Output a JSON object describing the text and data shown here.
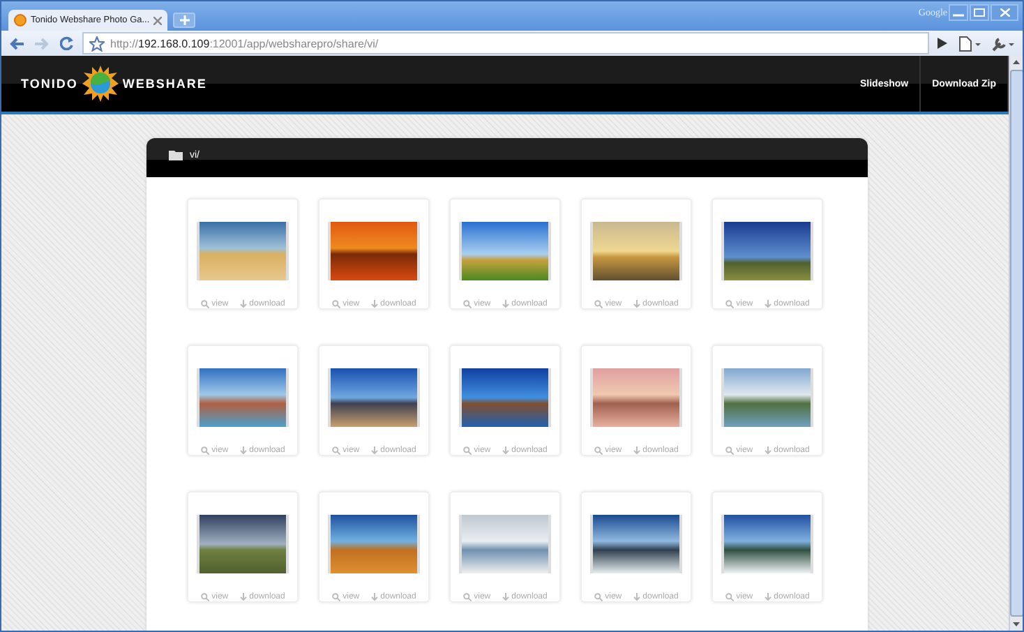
{
  "browser": {
    "tab_title": "Tonido Webshare Photo Ga...",
    "brand": "Google",
    "url": {
      "scheme": "http://",
      "host": "192.168.0.109",
      "rest": ":12001/app/websharepro/share/vi/"
    }
  },
  "header": {
    "logo_left": "TONIDO",
    "logo_right": "WEBSHARE",
    "nav": [
      "Slideshow",
      "Download Zip"
    ]
  },
  "folder": {
    "name": "vi/"
  },
  "photos": [
    {
      "view": "view",
      "download": "download"
    },
    {
      "view": "view",
      "download": "download"
    },
    {
      "view": "view",
      "download": "download"
    },
    {
      "view": "view",
      "download": "download"
    },
    {
      "view": "view",
      "download": "download"
    },
    {
      "view": "view",
      "download": "download"
    },
    {
      "view": "view",
      "download": "download"
    },
    {
      "view": "view",
      "download": "download"
    },
    {
      "view": "view",
      "download": "download"
    },
    {
      "view": "view",
      "download": "download"
    },
    {
      "view": "view",
      "download": "download"
    },
    {
      "view": "view",
      "download": "download"
    },
    {
      "view": "view",
      "download": "download"
    },
    {
      "view": "view",
      "download": "download"
    },
    {
      "view": "view",
      "download": "download"
    }
  ]
}
